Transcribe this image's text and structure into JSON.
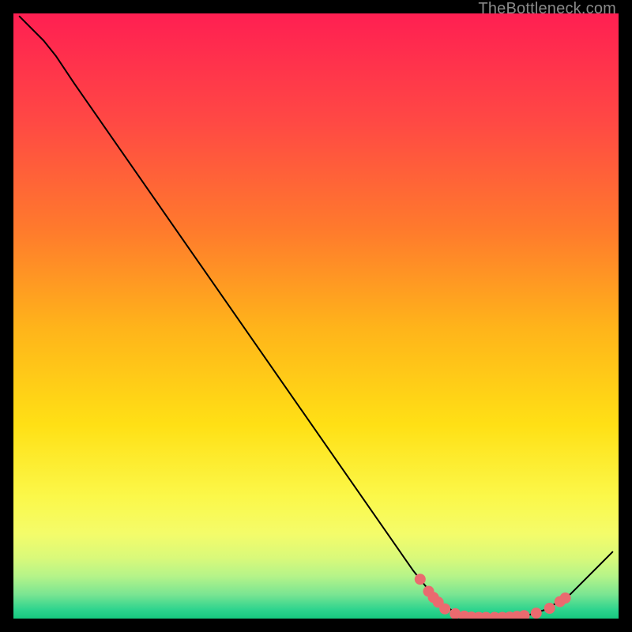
{
  "watermark": "TheBottleneck.com",
  "chart_data": {
    "type": "line",
    "title": "",
    "xlabel": "",
    "ylabel": "",
    "xlim": [
      0,
      100
    ],
    "ylim": [
      0,
      100
    ],
    "grid": false,
    "legend": false,
    "note": "Axes are unlabeled in the image; values below are read off as percentages of the plot area.",
    "gradient_bands": [
      {
        "pos": 0.0,
        "color": "#ff1f52"
      },
      {
        "pos": 0.18,
        "color": "#ff4944"
      },
      {
        "pos": 0.36,
        "color": "#ff7b2c"
      },
      {
        "pos": 0.52,
        "color": "#ffb41a"
      },
      {
        "pos": 0.68,
        "color": "#ffe015"
      },
      {
        "pos": 0.8,
        "color": "#fbf84a"
      },
      {
        "pos": 0.86,
        "color": "#f4fc6a"
      },
      {
        "pos": 0.9,
        "color": "#d9f97a"
      },
      {
        "pos": 0.93,
        "color": "#b5f489"
      },
      {
        "pos": 0.96,
        "color": "#7ae592"
      },
      {
        "pos": 0.985,
        "color": "#2fd48e"
      },
      {
        "pos": 1.0,
        "color": "#16c97f"
      }
    ],
    "series": [
      {
        "name": "curve",
        "stroke": "#000000",
        "stroke_width": 2,
        "points": [
          {
            "x": 1.0,
            "y": 99.5
          },
          {
            "x": 5.0,
            "y": 95.5
          },
          {
            "x": 7.0,
            "y": 93.0
          },
          {
            "x": 10.0,
            "y": 88.5
          },
          {
            "x": 66.0,
            "y": 8.0
          },
          {
            "x": 70.0,
            "y": 3.0
          },
          {
            "x": 73.0,
            "y": 1.0
          },
          {
            "x": 78.0,
            "y": 0.2
          },
          {
            "x": 84.0,
            "y": 0.2
          },
          {
            "x": 88.0,
            "y": 1.5
          },
          {
            "x": 92.0,
            "y": 4.0
          },
          {
            "x": 99.0,
            "y": 11.0
          }
        ]
      }
    ],
    "markers": {
      "name": "highlight-dots",
      "fill": "#ea6a6f",
      "radius": 7,
      "points": [
        {
          "x": 67.2,
          "y": 6.5
        },
        {
          "x": 68.6,
          "y": 4.5
        },
        {
          "x": 69.4,
          "y": 3.5
        },
        {
          "x": 70.2,
          "y": 2.7
        },
        {
          "x": 71.3,
          "y": 1.6
        },
        {
          "x": 73.0,
          "y": 0.8
        },
        {
          "x": 74.5,
          "y": 0.4
        },
        {
          "x": 75.7,
          "y": 0.25
        },
        {
          "x": 76.9,
          "y": 0.2
        },
        {
          "x": 78.1,
          "y": 0.2
        },
        {
          "x": 79.5,
          "y": 0.2
        },
        {
          "x": 80.8,
          "y": 0.2
        },
        {
          "x": 82.0,
          "y": 0.25
        },
        {
          "x": 83.2,
          "y": 0.35
        },
        {
          "x": 84.4,
          "y": 0.5
        },
        {
          "x": 86.4,
          "y": 0.9
        },
        {
          "x": 88.6,
          "y": 1.7
        },
        {
          "x": 90.3,
          "y": 2.8
        },
        {
          "x": 91.2,
          "y": 3.4
        }
      ]
    }
  }
}
